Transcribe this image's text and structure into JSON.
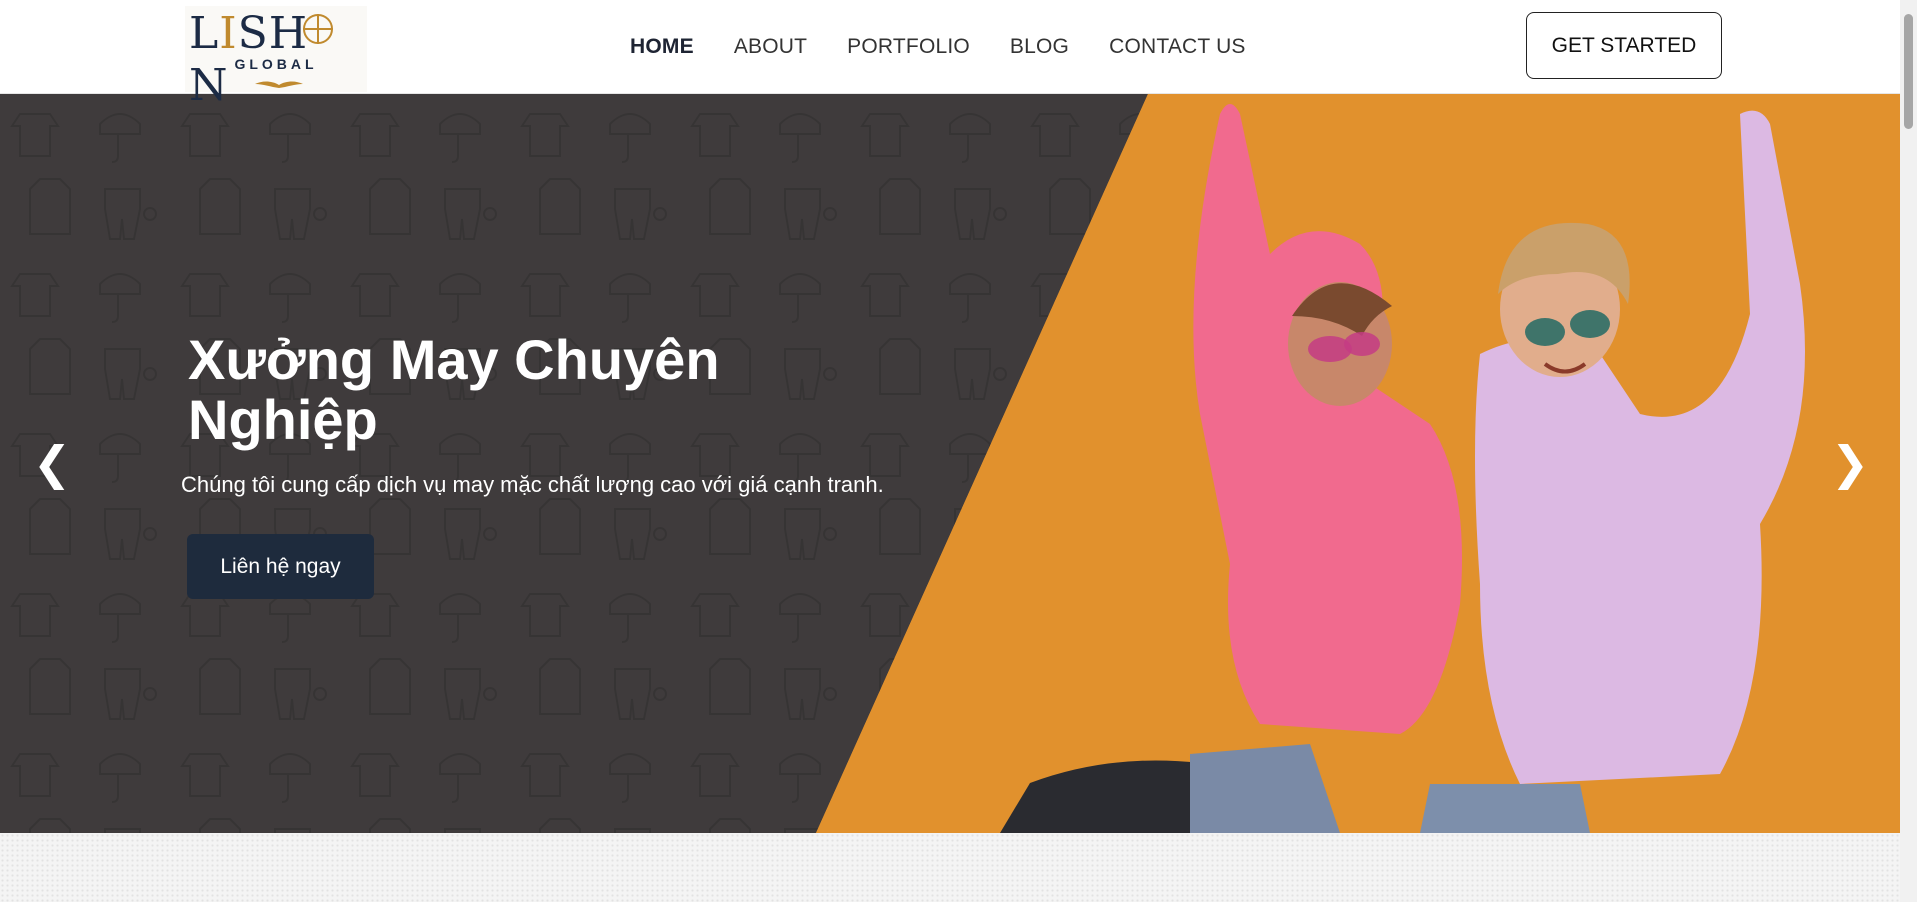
{
  "header": {
    "logo": {
      "main_prefix": "L",
      "main_i": "I",
      "main_rest": "SH",
      "main_suffix": "N",
      "sub": "GLOBAL"
    },
    "nav": [
      {
        "label": "HOME",
        "active": true
      },
      {
        "label": "ABOUT",
        "active": false
      },
      {
        "label": "PORTFOLIO",
        "active": false
      },
      {
        "label": "BLOG",
        "active": false
      },
      {
        "label": "CONTACT US",
        "active": false
      }
    ],
    "cta_label": "GET STARTED"
  },
  "hero": {
    "title": "Xưởng May Chuyên Nghiệp",
    "subtitle": "Chúng tôi cung cấp dịch vụ may mặc chất lượng cao với giá cạnh tranh.",
    "button_label": "Liên hệ ngay",
    "prev_arrow": "❮",
    "next_arrow": "❯",
    "colors": {
      "dark_panel": "#3f3b3c",
      "accent_bg": "#e5952f",
      "button": "#1e2b3d"
    }
  }
}
